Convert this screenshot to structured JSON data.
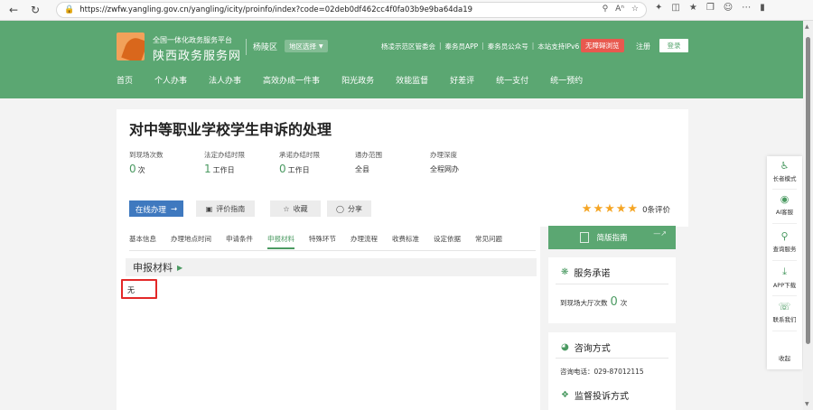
{
  "browser": {
    "url": "https://zwfw.yangling.gov.cn/yangling/icity/proinfo/index?code=02deb0df462cc4f0fa03b9e9ba64da19",
    "icons": [
      "back-icon",
      "reload-icon",
      "lock-icon",
      "zoom-icon",
      "read-aloud-icon",
      "favorite-icon",
      "extensions-icon",
      "split-icon",
      "favorites-bar-icon",
      "collections-icon",
      "profile-icon",
      "more-icon",
      "sidebar-icon"
    ]
  },
  "header": {
    "brand_small": "全国一体化政务服务平台",
    "brand_big": "陕西政务服务网",
    "region": "杨陵区",
    "region_select": "地区选择",
    "top_links": [
      "杨凌示范区管委会",
      "秦务员APP",
      "秦务员公众号",
      "本站支持IPv6"
    ],
    "barrier_free": "无障碍浏览",
    "register": "注册",
    "login": "登录",
    "nav": [
      "首页",
      "个人办事",
      "法人办事",
      "高效办成一件事",
      "阳光政务",
      "效能监督",
      "好差评",
      "统一支付",
      "统一预约"
    ],
    "colors": {
      "green": "#5ba772",
      "red": "#e8594f"
    }
  },
  "title_card": {
    "title": "对中等职业学校学生申诉的处理",
    "stats": [
      {
        "label": "到现场次数",
        "value": "0",
        "unit": "次"
      },
      {
        "label": "法定办结时限",
        "value": "1",
        "unit": "工作日"
      },
      {
        "label": "承诺办结时限",
        "value": "0",
        "unit": "工作日"
      },
      {
        "label": "通办范围",
        "text": "全县"
      },
      {
        "label": "办理深度",
        "text": "全程网办"
      }
    ],
    "btn_online": "在线办理",
    "btn_guide": "评价指南",
    "btn_collect": "收藏",
    "btn_share": "分享",
    "rating_stars": 5,
    "rating_text": "0条评价"
  },
  "content": {
    "tabs": [
      "基本信息",
      "办理地点时间",
      "申请条件",
      "申报材料",
      "特殊环节",
      "办理流程",
      "收费标准",
      "设定依据",
      "常见问题"
    ],
    "active_tab": "申报材料",
    "section_title": "申报材料",
    "material_value": "无"
  },
  "sidebar": {
    "guide_button": "简版指南",
    "service_commit_title": "服务承诺",
    "visit_label": "到现场大厅次数",
    "visit_value": "0",
    "visit_unit": "次",
    "consult_title": "咨询方式",
    "consult_phone": "咨询电话：029-87012115",
    "complaint_title": "监督投诉方式"
  },
  "float_bar": {
    "items": [
      "长者模式",
      "AI客服",
      "查询服务",
      "APP下载",
      "联系我们",
      "收起"
    ]
  }
}
